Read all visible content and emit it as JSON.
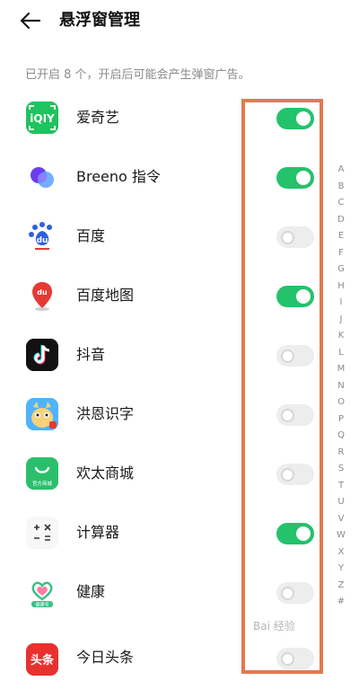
{
  "header": {
    "title": "悬浮窗管理",
    "back_icon": "arrow-left-icon"
  },
  "subtitle": "已开启 8 个，开启后可能会产生弹窗广告。",
  "apps": [
    {
      "name": "爱奇艺",
      "icon": "iqiyi-icon",
      "enabled": true
    },
    {
      "name": "Breeno 指令",
      "icon": "breeno-icon",
      "enabled": true
    },
    {
      "name": "百度",
      "icon": "baidu-icon",
      "enabled": false
    },
    {
      "name": "百度地图",
      "icon": "baidu-map-icon",
      "enabled": true
    },
    {
      "name": "抖音",
      "icon": "douyin-icon",
      "enabled": false
    },
    {
      "name": "洪恩识字",
      "icon": "hongen-icon",
      "enabled": false
    },
    {
      "name": "欢太商城",
      "icon": "heytap-mall-icon",
      "enabled": false
    },
    {
      "name": "计算器",
      "icon": "calculator-icon",
      "enabled": true
    },
    {
      "name": "健康",
      "icon": "health-icon",
      "enabled": false
    },
    {
      "name": "今日头条",
      "icon": "toutiao-icon",
      "enabled": false
    }
  ],
  "icon_text": {
    "iqiyi": "iQIY",
    "baidu": "du",
    "baidu_map": "du",
    "mall": "官方商城",
    "calc": "+ ×\n− =",
    "health": "健康号",
    "toutiao": "头条"
  },
  "alpha_index": [
    "A",
    "B",
    "C",
    "D",
    "E",
    "F",
    "G",
    "H",
    "I",
    "J",
    "K",
    "L",
    "M",
    "N",
    "O",
    "P",
    "Q",
    "R",
    "S",
    "T",
    "U",
    "V",
    "W",
    "X",
    "Y",
    "Z",
    "#"
  ],
  "watermark": "Bai 经验",
  "colors": {
    "toggle_on": "#23c26b",
    "toggle_off": "#ededed",
    "highlight": "#e5784f"
  }
}
